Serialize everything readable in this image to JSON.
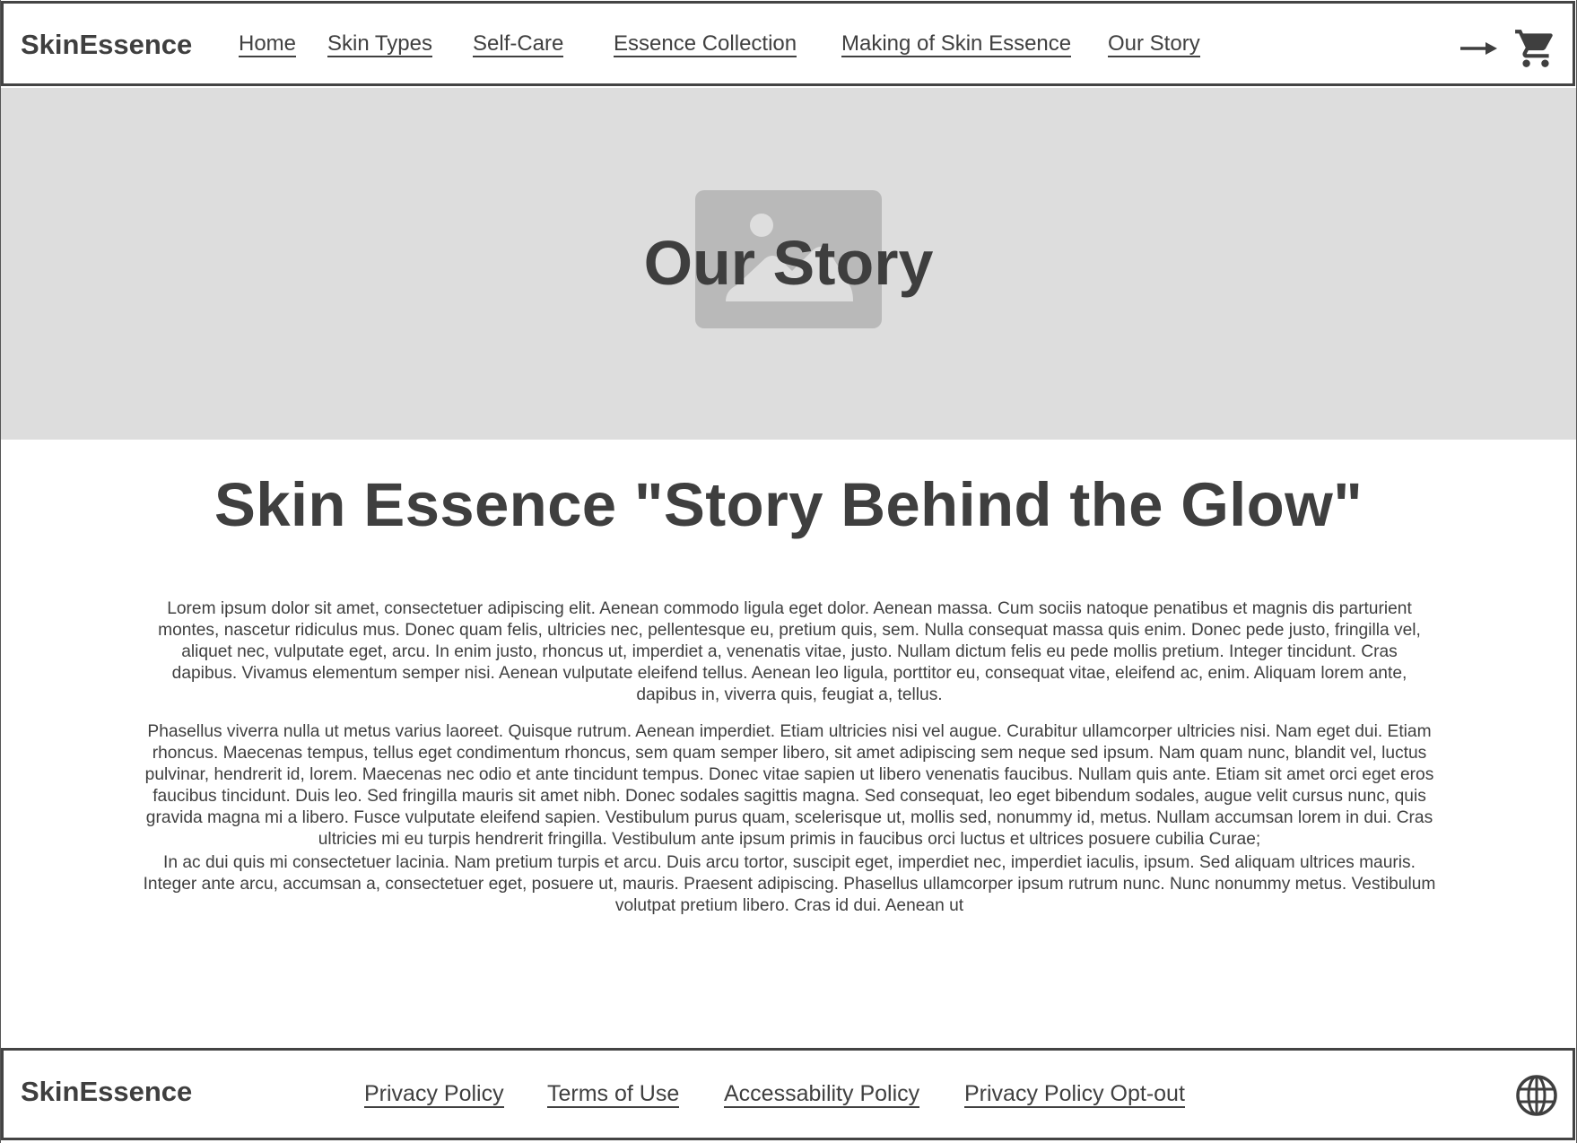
{
  "header": {
    "brand": "SkinEssence",
    "nav": [
      {
        "label": "Home"
      },
      {
        "label": "Skin Types"
      },
      {
        "label": "Self-Care"
      },
      {
        "label": "Essence Collection"
      },
      {
        "label": "Making of Skin Essence"
      },
      {
        "label": "Our Story"
      }
    ],
    "icons": [
      "arrow-right-icon",
      "shopping-cart-icon"
    ]
  },
  "hero": {
    "title": "Our Story",
    "image": "image-placeholder-icon",
    "background": "#dddddd"
  },
  "main": {
    "heading": "Skin Essence \"Story Behind the Glow\"",
    "paragraphs": [
      "Lorem ipsum dolor sit amet, consectetuer adipiscing elit. Aenean commodo ligula eget dolor. Aenean massa. Cum sociis natoque penatibus et magnis dis parturient montes, nascetur ridiculus mus. Donec quam felis, ultricies nec, pellentesque eu, pretium quis, sem. Nulla consequat massa quis enim. Donec pede justo, fringilla vel, aliquet nec, vulputate eget, arcu. In enim justo, rhoncus ut, imperdiet a, venenatis vitae, justo. Nullam dictum felis eu pede mollis pretium. Integer tincidunt. Cras dapibus. Vivamus elementum semper nisi. Aenean vulputate eleifend tellus. Aenean leo ligula, porttitor eu, consequat vitae, eleifend ac, enim. Aliquam lorem ante, dapibus in, viverra quis, feugiat a, tellus.",
      "Phasellus viverra nulla ut metus varius laoreet. Quisque rutrum. Aenean imperdiet. Etiam ultricies nisi vel augue. Curabitur ullamcorper ultricies nisi. Nam eget dui. Etiam rhoncus. Maecenas tempus, tellus eget condimentum rhoncus, sem quam semper libero, sit amet adipiscing sem neque sed ipsum. Nam quam nunc, blandit vel, luctus pulvinar, hendrerit id, lorem. Maecenas nec odio et ante tincidunt tempus. Donec vitae sapien ut libero venenatis faucibus. Nullam quis ante. Etiam sit amet orci eget eros faucibus tincidunt. Duis leo. Sed fringilla mauris sit amet nibh. Donec sodales sagittis magna. Sed consequat, leo eget bibendum sodales, augue velit cursus nunc, quis gravida magna mi a libero. Fusce vulputate eleifend sapien. Vestibulum purus quam, scelerisque ut, mollis sed, nonummy id, metus. Nullam accumsan lorem in dui. Cras ultricies mi eu turpis hendrerit fringilla. Vestibulum ante ipsum primis in faucibus orci luctus et ultrices posuere cubilia Curae;",
      "In ac dui quis mi consectetuer lacinia. Nam pretium turpis et arcu. Duis arcu tortor, suscipit eget, imperdiet nec, imperdiet iaculis, ipsum. Sed aliquam ultrices mauris. Integer ante arcu, accumsan a, consectetuer eget, posuere ut, mauris. Praesent adipiscing. Phasellus ullamcorper ipsum rutrum nunc. Nunc nonummy metus. Vestibulum volutpat pretium libero. Cras id dui. Aenean ut"
    ]
  },
  "footer": {
    "brand": "SkinEssence",
    "links": [
      {
        "label": "Privacy Policy"
      },
      {
        "label": "Terms of Use"
      },
      {
        "label": "Accessability Policy"
      },
      {
        "label": "Privacy Policy Opt-out"
      }
    ],
    "icon": "globe-icon"
  },
  "colors": {
    "text": "#404040",
    "border": "#444444",
    "hero_bg": "#dddddd",
    "placeholder": "#b9b9b9"
  }
}
